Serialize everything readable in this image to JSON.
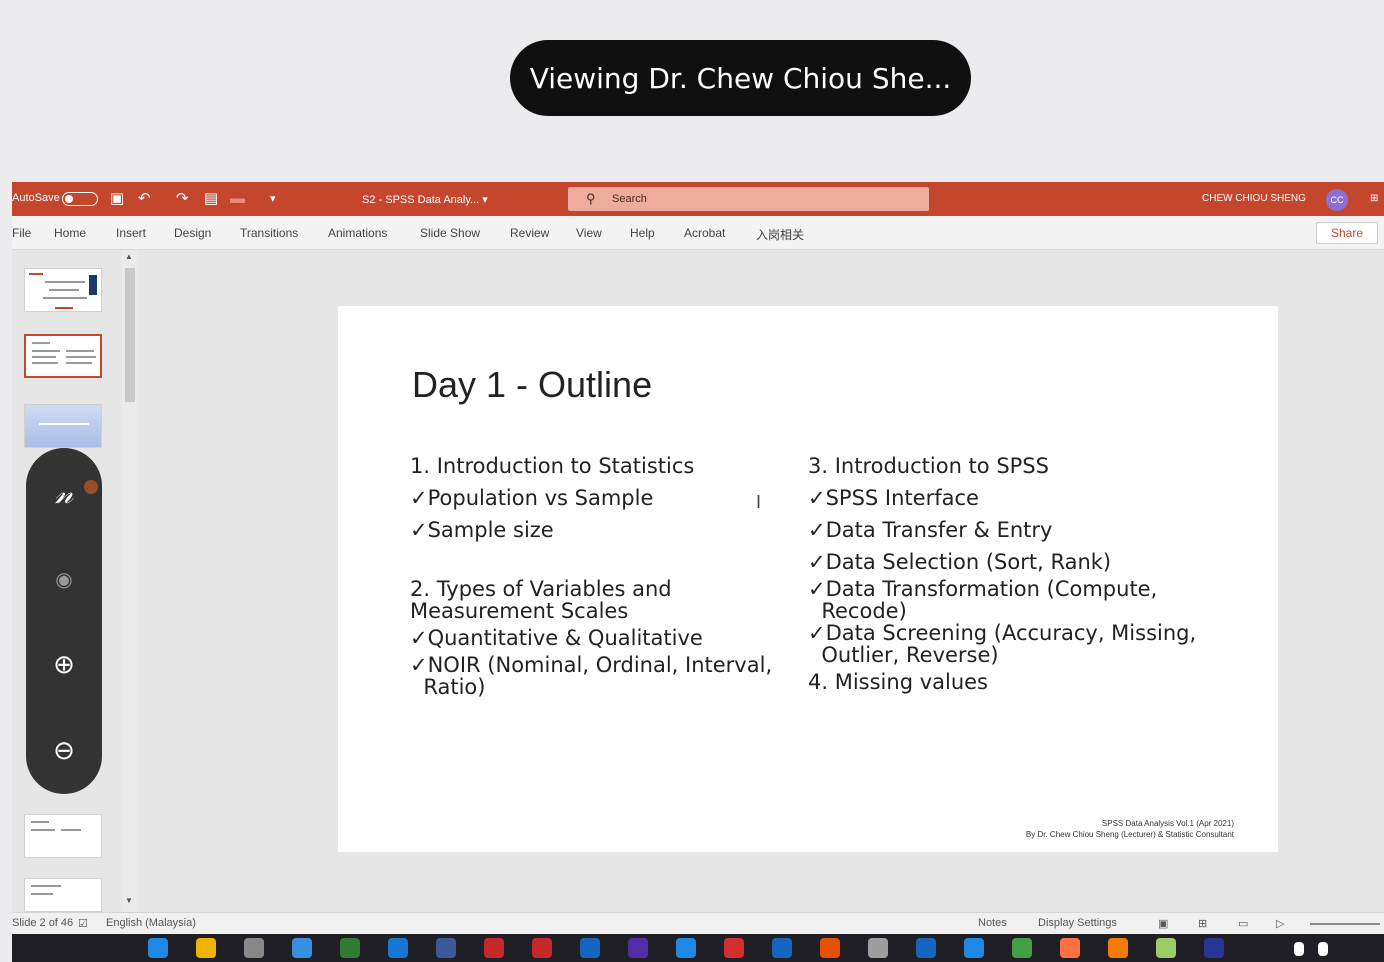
{
  "share_banner": {
    "text": "Viewing Dr. Chew Chiou She..."
  },
  "titlebar": {
    "autosave": "AutoSave",
    "toggle_state": "Off",
    "document": "S2 - SPSS Data Analy... ▾",
    "search_placeholder": "Search",
    "user_name": "CHEW CHIOU SHENG",
    "avatar_initials": "CC"
  },
  "ribbon": {
    "tabs": [
      "File",
      "Home",
      "Insert",
      "Design",
      "Transitions",
      "Animations",
      "Slide Show",
      "Review",
      "View",
      "Help",
      "Acrobat",
      "入岗相关"
    ],
    "share_label": "Share"
  },
  "slide": {
    "title": "Day 1 - Outline",
    "left_column": [
      "1. Introduction to Statistics",
      "✓Population vs Sample",
      "✓Sample size",
      "",
      "2. Types of Variables and",
      "Measurement Scales",
      "✓Quantitative & Qualitative",
      "✓NOIR (Nominal, Ordinal, Interval,",
      "  Ratio)"
    ],
    "right_column": [
      "3. Introduction to SPSS",
      "✓SPSS Interface",
      "✓Data Transfer & Entry",
      "✓Data Selection (Sort, Rank)",
      "✓Data Transformation (Compute,",
      "  Recode)",
      "✓Data Screening (Accuracy, Missing,",
      "  Outlier, Reverse)",
      "4. Missing values"
    ],
    "footer_line1": "SPSS Data Analysis Vol.1 (Apr 2021)",
    "footer_line2": "By Dr. Chew Chiou Sheng (Lecturer) & Statistic Consultant"
  },
  "statusbar": {
    "slide_info": "Slide 2 of 46",
    "language": "English (Malaysia)",
    "notes": "Notes",
    "display_settings": "Display Settings"
  }
}
